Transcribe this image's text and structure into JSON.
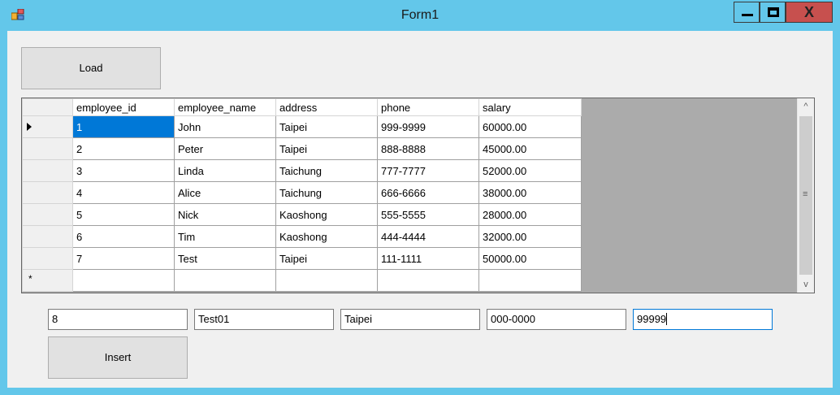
{
  "window": {
    "title": "Form1"
  },
  "controls": {
    "minimize_icon": "minimize-icon",
    "maximize_icon": "maximize-icon",
    "close_label": "X"
  },
  "buttons": {
    "load": "Load",
    "insert": "Insert"
  },
  "grid": {
    "columns": [
      "employee_id",
      "employee_name",
      "address",
      "phone",
      "salary"
    ],
    "rows": [
      [
        "1",
        "John",
        "Taipei",
        "999-9999",
        "60000.00"
      ],
      [
        "2",
        "Peter",
        "Taipei",
        "888-8888",
        "45000.00"
      ],
      [
        "3",
        "Linda",
        "Taichung",
        "777-7777",
        "52000.00"
      ],
      [
        "4",
        "Alice",
        "Taichung",
        "666-6666",
        "38000.00"
      ],
      [
        "5",
        "Nick",
        "Kaoshong",
        "555-5555",
        "28000.00"
      ],
      [
        "6",
        "Tim",
        "Kaoshong",
        "444-4444",
        "32000.00"
      ],
      [
        "7",
        "Test",
        "Taipei",
        "111-1111",
        "50000.00"
      ]
    ],
    "new_row_marker": "*",
    "scroll_up": "^",
    "scroll_down": "v",
    "scroll_grip": "≡"
  },
  "inputs": {
    "employee_id": "8",
    "employee_name": "Test01",
    "address": "Taipei",
    "phone": "000-0000",
    "salary": "99999"
  },
  "colors": {
    "titlebar": "#63c7ea",
    "close_button": "#c7504e",
    "selection": "#0078d7",
    "grid_background": "#ababab"
  }
}
